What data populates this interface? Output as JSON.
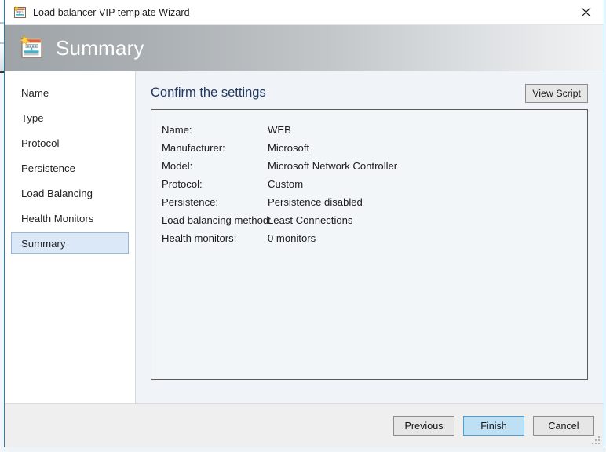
{
  "window": {
    "title": "Load balancer VIP template Wizard",
    "title_icon": "load-balancer-template-icon",
    "close_icon": "close-icon"
  },
  "header": {
    "title": "Summary",
    "icon": "load-balancer-template-icon"
  },
  "sidebar": {
    "items": [
      {
        "label": "Name",
        "selected": false
      },
      {
        "label": "Type",
        "selected": false
      },
      {
        "label": "Protocol",
        "selected": false
      },
      {
        "label": "Persistence",
        "selected": false
      },
      {
        "label": "Load Balancing",
        "selected": false
      },
      {
        "label": "Health Monitors",
        "selected": false
      },
      {
        "label": "Summary",
        "selected": true
      }
    ]
  },
  "content": {
    "heading": "Confirm the settings",
    "view_script_label": "View Script",
    "summary_rows": [
      {
        "label": "Name:",
        "value": "WEB"
      },
      {
        "label": "Manufacturer:",
        "value": "Microsoft"
      },
      {
        "label": "Model:",
        "value": "Microsoft Network Controller"
      },
      {
        "label": "Protocol:",
        "value": "Custom"
      },
      {
        "label": "Persistence:",
        "value": "Persistence disabled"
      },
      {
        "label": "Load balancing method:",
        "value": "Least Connections"
      },
      {
        "label": "Health monitors:",
        "value": "0 monitors"
      }
    ]
  },
  "footer": {
    "previous_label": "Previous",
    "finish_label": "Finish",
    "cancel_label": "Cancel",
    "resize_grip_icon": "resize-grip-icon"
  },
  "colors": {
    "window_border": "#2e7ca6",
    "heading_text": "#1f3864",
    "selection_fill": "#dbe8f7",
    "selection_border": "#9cb6d4",
    "primary_button_fill": "#bee0f5",
    "primary_button_border": "#48a2d8"
  }
}
